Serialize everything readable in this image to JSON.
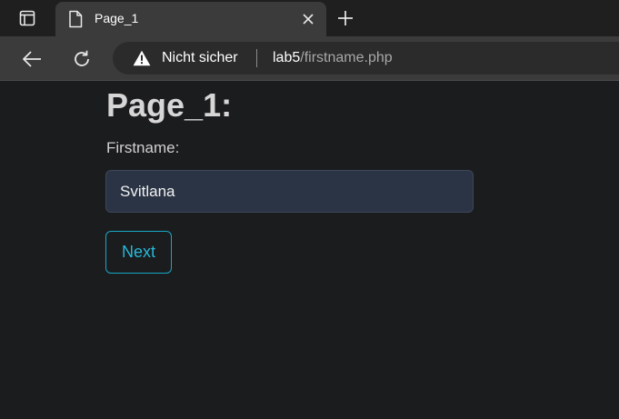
{
  "tab": {
    "title": "Page_1"
  },
  "toolbar": {
    "security_label": "Nicht sicher",
    "url_host": "lab5",
    "url_path": "/firstname.php"
  },
  "page": {
    "title": "Page_1:",
    "field_label": "Firstname:",
    "firstname_value": "Svitlana",
    "next_label": "Next"
  },
  "colors": {
    "page_background": "#1b1c1e",
    "input_background": "#2b3444",
    "button_accent": "#26b9d8"
  },
  "icons": {
    "tab_actions": "tab-actions-icon",
    "tab_page": "document-icon",
    "tab_close": "close-icon",
    "new_tab": "plus-icon",
    "back": "back-arrow-icon",
    "reload": "reload-icon",
    "security": "warning-triangle-icon"
  }
}
